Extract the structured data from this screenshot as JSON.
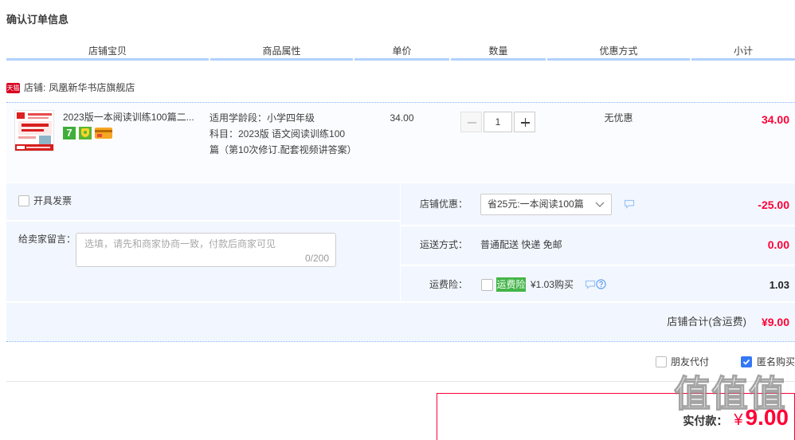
{
  "page": {
    "title": "确认订单信息"
  },
  "table_header": {
    "columns": [
      "店铺宝贝",
      "商品属性",
      "单价",
      "数量",
      "优惠方式",
      "小计"
    ]
  },
  "shop": {
    "badge": "天猫",
    "label": "店铺:",
    "name": "凤凰新华书店旗舰店"
  },
  "item": {
    "title": "2023版一本阅读训练100篇二...",
    "service_icons": [
      {
        "icon": "seven-day-return-icon",
        "text": "7"
      },
      {
        "icon": "consumer-guarantee-icon"
      },
      {
        "icon": "credit-card-icon"
      }
    ],
    "attributes": [
      "适用学龄段：小学四年级",
      "科目：2023版 语文阅读训练100篇（第10次修订.配套视频讲答案）"
    ],
    "unit_price": "34.00",
    "quantity": "1",
    "discount": "无优惠",
    "subtotal": "34.00"
  },
  "invoice": {
    "label": "开具发票",
    "checked": false
  },
  "message": {
    "label": "给卖家留言：",
    "placeholder": "选填，请先和商家协商一致，付款后商家可见",
    "value": "",
    "counter": "0/200"
  },
  "shop_discount": {
    "label": "店铺优惠：",
    "selected": "省25元:一本阅读100篇",
    "amount": "-25.00"
  },
  "shipping": {
    "label": "运送方式：",
    "method": "普通配送 快递 免邮",
    "amount": "0.00"
  },
  "shipping_insurance": {
    "label": "运费险：",
    "checked": false,
    "badge": "运费险",
    "price_text": "¥1.03购买",
    "amount": "1.03"
  },
  "shop_total": {
    "label": "店铺合计(含运费)",
    "amount": "¥9.00"
  },
  "options": {
    "pay_for_me": {
      "label": "朋友代付",
      "checked": false
    },
    "anonymous": {
      "label": "匿名购买",
      "checked": true
    }
  },
  "payment": {
    "label": "实付款：",
    "currency": "¥",
    "amount": "9.00"
  },
  "watermark": {
    "glyphs": "值值值"
  },
  "colors": {
    "accent_red": "#ff0036",
    "header_line": "#b2d1ff",
    "panel_bg": "#f2f7ff",
    "checkbox_blue": "#3478f6",
    "insurance_green": "#44b549",
    "tmall_red": "#d7001f"
  }
}
